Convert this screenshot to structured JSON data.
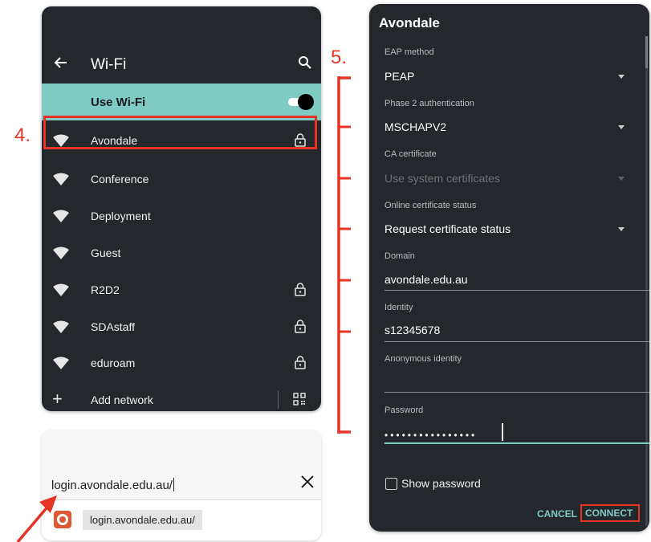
{
  "wifi": {
    "title": "Wi-Fi",
    "use_wifi_label": "Use Wi-Fi",
    "use_wifi_on": true,
    "networks": [
      {
        "name": "Avondale",
        "locked": true
      },
      {
        "name": "Conference",
        "locked": false
      },
      {
        "name": "Deployment",
        "locked": false
      },
      {
        "name": "Guest",
        "locked": false
      },
      {
        "name": "R2D2",
        "locked": true
      },
      {
        "name": "SDAstaff",
        "locked": true
      },
      {
        "name": "eduroam",
        "locked": true
      }
    ],
    "add_network_label": "Add network",
    "icons": {
      "back": "back-arrow-icon",
      "search": "search-icon",
      "wifi": "wifi-icon",
      "lock": "lock-icon",
      "add": "plus-icon",
      "qr": "qr-code-icon"
    }
  },
  "browser": {
    "url_value": "login.avondale.edu.au/",
    "suggestion": "login.avondale.edu.au/",
    "icons": {
      "clear": "close-icon",
      "engine": "duckduckgo-icon"
    }
  },
  "config": {
    "title": "Avondale",
    "eap_method": {
      "label": "EAP method",
      "value": "PEAP"
    },
    "phase2": {
      "label": "Phase 2 authentication",
      "value": "MSCHAPV2"
    },
    "ca_cert": {
      "label": "CA certificate",
      "value": "Use system certificates"
    },
    "ocsp": {
      "label": "Online certificate status",
      "value": "Request certificate status"
    },
    "domain": {
      "label": "Domain",
      "value": "avondale.edu.au"
    },
    "identity": {
      "label": "Identity",
      "value": "s12345678"
    },
    "anon_identity": {
      "label": "Anonymous identity",
      "value": ""
    },
    "password": {
      "label": "Password",
      "masked_value": "••••••••••••••••"
    },
    "show_password_label": "Show password",
    "show_password_checked": false,
    "cancel_label": "CANCEL",
    "connect_label": "CONNECT"
  },
  "annotations": {
    "step4": "4.",
    "step5": "5.",
    "color": "#e53325"
  },
  "colors": {
    "panel_bg": "#24272b",
    "accent": "#7fcbc4",
    "annotation_red": "#e53325"
  }
}
